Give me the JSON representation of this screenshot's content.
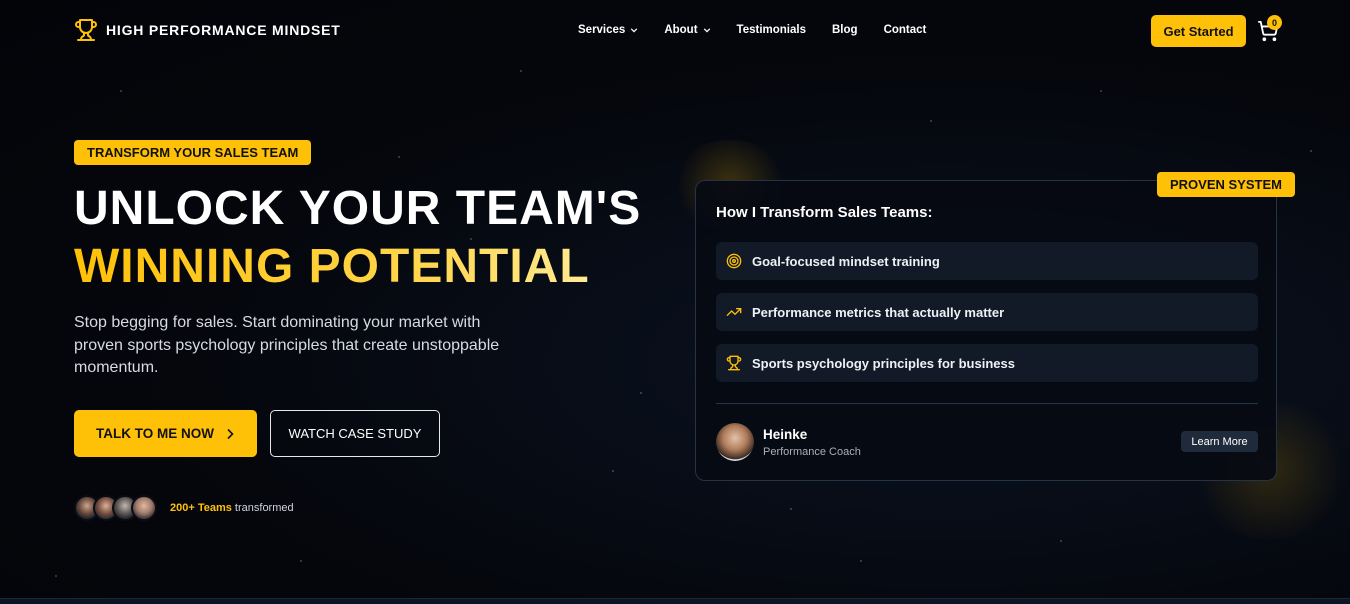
{
  "brand": {
    "name": "HIGH PERFORMANCE MINDSET",
    "icon": "trophy-icon",
    "accent": "#ffc107"
  },
  "nav": {
    "items": [
      {
        "label": "Services",
        "dropdown": true
      },
      {
        "label": "About",
        "dropdown": true
      },
      {
        "label": "Testimonials",
        "dropdown": false
      },
      {
        "label": "Blog",
        "dropdown": false
      },
      {
        "label": "Contact",
        "dropdown": false
      }
    ],
    "cta": "Get Started",
    "cart_count": "0"
  },
  "hero": {
    "tag": "TRANSFORM YOUR SALES TEAM",
    "title_line1": "UNLOCK YOUR TEAM'S",
    "title_line2": "WINNING POTENTIAL",
    "subtitle": "Stop begging for sales. Start dominating your market with proven sports psychology principles that create unstoppable momentum.",
    "primary_button": "TALK TO ME NOW",
    "secondary_button": "WATCH CASE STUDY",
    "social_proof_highlight": "200+ Teams",
    "social_proof_rest": " transformed"
  },
  "card": {
    "badge": "PROVEN SYSTEM",
    "title": "How I Transform Sales Teams:",
    "features": [
      {
        "icon": "target-icon",
        "label": "Goal-focused mindset training"
      },
      {
        "icon": "trending-up-icon",
        "label": "Performance metrics that actually matter"
      },
      {
        "icon": "trophy-icon",
        "label": "Sports psychology principles for business"
      }
    ],
    "coach": {
      "name": "Heinke",
      "role": "Performance Coach"
    },
    "learn_more": "Learn More"
  }
}
